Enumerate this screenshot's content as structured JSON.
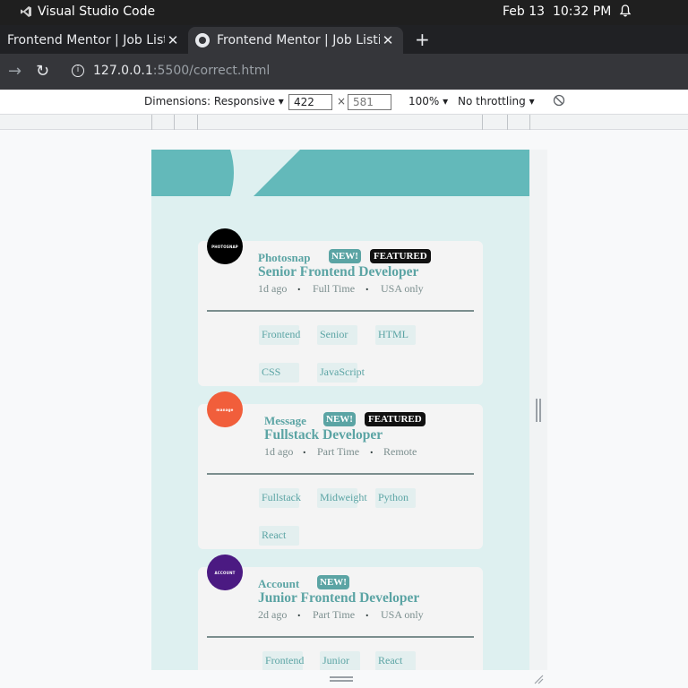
{
  "os": {
    "app_name": "Visual Studio Code",
    "datetime": "Feb 13  10:32 PM"
  },
  "browser": {
    "tabs": [
      {
        "title": "Frontend Mentor | Job Listings",
        "active": false
      },
      {
        "title": "Frontend Mentor | Job Listings",
        "active": true
      }
    ],
    "new_tab_label": "+",
    "url_host": "127.0.0.1",
    "url_path": ":5500/correct.html"
  },
  "devtools": {
    "dimensions_label": "Dimensions: Responsive ▾",
    "width": "422",
    "height": "581",
    "times": "×",
    "zoom": "100% ▾",
    "throttling": "No throttling ▾"
  },
  "colors": {
    "primary": "#5ba4a4",
    "header": "#63b9ba",
    "background": "#def0f0",
    "card": "#f4f4f4"
  },
  "jobs": [
    {
      "company": "Photosnap",
      "logo_text": "PHOTOSNAP",
      "logo_color": "#000000",
      "is_new": true,
      "is_featured": true,
      "new_label": "NEW!",
      "featured_label": "FEATURED",
      "position": "Senior Frontend Developer",
      "posted": "1d ago",
      "contract": "Full Time",
      "location": "USA only",
      "tags": [
        "Frontend",
        "Senior",
        "HTML",
        "CSS",
        "JavaScript"
      ]
    },
    {
      "company": "Message",
      "logo_text": "manage",
      "logo_color": "#f15e3b",
      "is_new": true,
      "is_featured": true,
      "new_label": "NEW!",
      "featured_label": "FEATURED",
      "position": "Fullstack Developer",
      "posted": "1d ago",
      "contract": "Part Time",
      "location": "Remote",
      "tags": [
        "Fullstack",
        "Midweight",
        "Python",
        "React"
      ]
    },
    {
      "company": "Account",
      "logo_text": "ACCOUNT",
      "logo_color": "#4b1a82",
      "is_new": true,
      "is_featured": false,
      "new_label": "NEW!",
      "position": "Junior Frontend Developer",
      "posted": "2d ago",
      "contract": "Part Time",
      "location": "USA only",
      "tags": [
        "Frontend",
        "Junior",
        "React"
      ]
    }
  ]
}
